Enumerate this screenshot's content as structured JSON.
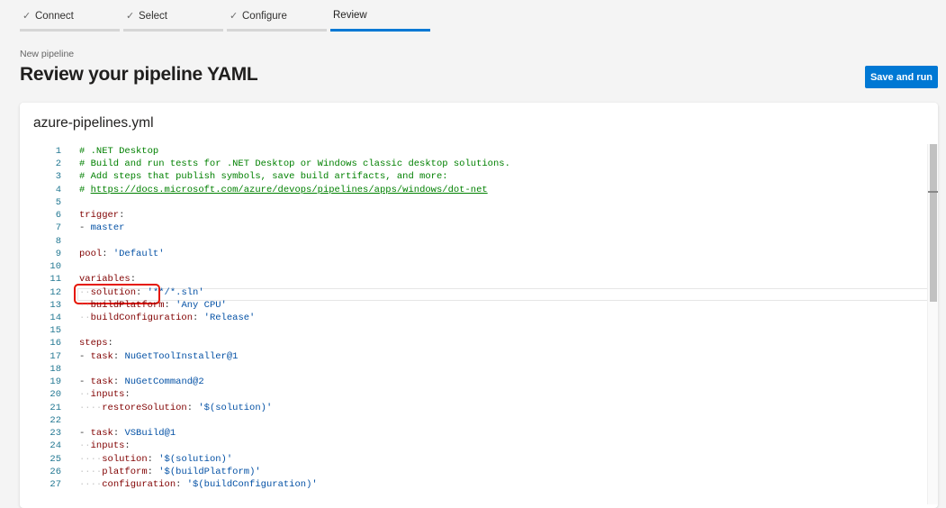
{
  "wizard": {
    "steps": [
      {
        "label": "Connect",
        "done": true
      },
      {
        "label": "Select",
        "done": true
      },
      {
        "label": "Configure",
        "done": true
      },
      {
        "label": "Review",
        "done": false,
        "active": true
      }
    ],
    "check_glyph": "✓"
  },
  "header": {
    "subtitle": "New pipeline",
    "title": "Review your pipeline YAML",
    "save_run_label": "Save and run"
  },
  "editor": {
    "file_name": "azure-pipelines.yml",
    "highlighted_line": 9,
    "lines": [
      {
        "n": "1",
        "tokens": [
          {
            "t": "# .NET Desktop",
            "c": "c"
          }
        ]
      },
      {
        "n": "2",
        "tokens": [
          {
            "t": "# Build and run tests for .NET Desktop or Windows classic desktop solutions.",
            "c": "c"
          }
        ]
      },
      {
        "n": "3",
        "tokens": [
          {
            "t": "# Add steps that publish symbols, save build artifacts, and more:",
            "c": "c"
          }
        ]
      },
      {
        "n": "4",
        "tokens": [
          {
            "t": "# ",
            "c": "c"
          },
          {
            "t": "https://docs.microsoft.com/azure/devops/pipelines/apps/windows/dot-net",
            "c": "u"
          }
        ]
      },
      {
        "n": "5",
        "tokens": []
      },
      {
        "n": "6",
        "tokens": [
          {
            "t": "trigger",
            "c": "k"
          },
          {
            "t": ":",
            "c": "p"
          }
        ]
      },
      {
        "n": "7",
        "tokens": [
          {
            "t": "- ",
            "c": "p"
          },
          {
            "t": "master",
            "c": "s"
          }
        ]
      },
      {
        "n": "8",
        "tokens": []
      },
      {
        "n": "9",
        "tokens": [
          {
            "t": "pool",
            "c": "k"
          },
          {
            "t": ": ",
            "c": "p"
          },
          {
            "t": "'Default'",
            "c": "s"
          }
        ]
      },
      {
        "n": "10",
        "tokens": []
      },
      {
        "n": "11",
        "tokens": [
          {
            "t": "variables",
            "c": "k"
          },
          {
            "t": ":",
            "c": "p"
          }
        ]
      },
      {
        "n": "12",
        "tokens": [
          {
            "t": "  ",
            "c": "ws"
          },
          {
            "t": "solution",
            "c": "k"
          },
          {
            "t": ": ",
            "c": "p"
          },
          {
            "t": "'**/*.sln'",
            "c": "s"
          }
        ]
      },
      {
        "n": "13",
        "tokens": [
          {
            "t": "  ",
            "c": "ws"
          },
          {
            "t": "buildPlatform",
            "c": "k"
          },
          {
            "t": ": ",
            "c": "p"
          },
          {
            "t": "'Any CPU'",
            "c": "s"
          }
        ]
      },
      {
        "n": "14",
        "tokens": [
          {
            "t": "  ",
            "c": "ws"
          },
          {
            "t": "buildConfiguration",
            "c": "k"
          },
          {
            "t": ": ",
            "c": "p"
          },
          {
            "t": "'Release'",
            "c": "s"
          }
        ]
      },
      {
        "n": "15",
        "tokens": []
      },
      {
        "n": "16",
        "tokens": [
          {
            "t": "steps",
            "c": "k"
          },
          {
            "t": ":",
            "c": "p"
          }
        ]
      },
      {
        "n": "17",
        "tokens": [
          {
            "t": "- ",
            "c": "p"
          },
          {
            "t": "task",
            "c": "k"
          },
          {
            "t": ": ",
            "c": "p"
          },
          {
            "t": "NuGetToolInstaller@1",
            "c": "s"
          }
        ]
      },
      {
        "n": "18",
        "tokens": []
      },
      {
        "n": "19",
        "tokens": [
          {
            "t": "- ",
            "c": "p"
          },
          {
            "t": "task",
            "c": "k"
          },
          {
            "t": ": ",
            "c": "p"
          },
          {
            "t": "NuGetCommand@2",
            "c": "s"
          }
        ]
      },
      {
        "n": "20",
        "tokens": [
          {
            "t": "  ",
            "c": "ws"
          },
          {
            "t": "inputs",
            "c": "k"
          },
          {
            "t": ":",
            "c": "p"
          }
        ]
      },
      {
        "n": "21",
        "tokens": [
          {
            "t": "    ",
            "c": "ws"
          },
          {
            "t": "restoreSolution",
            "c": "k"
          },
          {
            "t": ": ",
            "c": "p"
          },
          {
            "t": "'$(solution)'",
            "c": "s"
          }
        ]
      },
      {
        "n": "22",
        "tokens": []
      },
      {
        "n": "23",
        "tokens": [
          {
            "t": "- ",
            "c": "p"
          },
          {
            "t": "task",
            "c": "k"
          },
          {
            "t": ": ",
            "c": "p"
          },
          {
            "t": "VSBuild@1",
            "c": "s"
          }
        ]
      },
      {
        "n": "24",
        "tokens": [
          {
            "t": "  ",
            "c": "ws"
          },
          {
            "t": "inputs",
            "c": "k"
          },
          {
            "t": ":",
            "c": "p"
          }
        ]
      },
      {
        "n": "25",
        "tokens": [
          {
            "t": "    ",
            "c": "ws"
          },
          {
            "t": "solution",
            "c": "k"
          },
          {
            "t": ": ",
            "c": "p"
          },
          {
            "t": "'$(solution)'",
            "c": "s"
          }
        ]
      },
      {
        "n": "26",
        "tokens": [
          {
            "t": "    ",
            "c": "ws"
          },
          {
            "t": "platform",
            "c": "k"
          },
          {
            "t": ": ",
            "c": "p"
          },
          {
            "t": "'$(buildPlatform)'",
            "c": "s"
          }
        ]
      },
      {
        "n": "27",
        "tokens": [
          {
            "t": "    ",
            "c": "ws"
          },
          {
            "t": "configuration",
            "c": "k"
          },
          {
            "t": ": ",
            "c": "p"
          },
          {
            "t": "'$(buildConfiguration)'",
            "c": "s"
          }
        ]
      }
    ]
  },
  "colors": {
    "accent": "#0078d4",
    "highlight_outline": "#e51400",
    "comment": "#008000",
    "key": "#800000",
    "string": "#0451a5",
    "line_number": "#237893"
  }
}
